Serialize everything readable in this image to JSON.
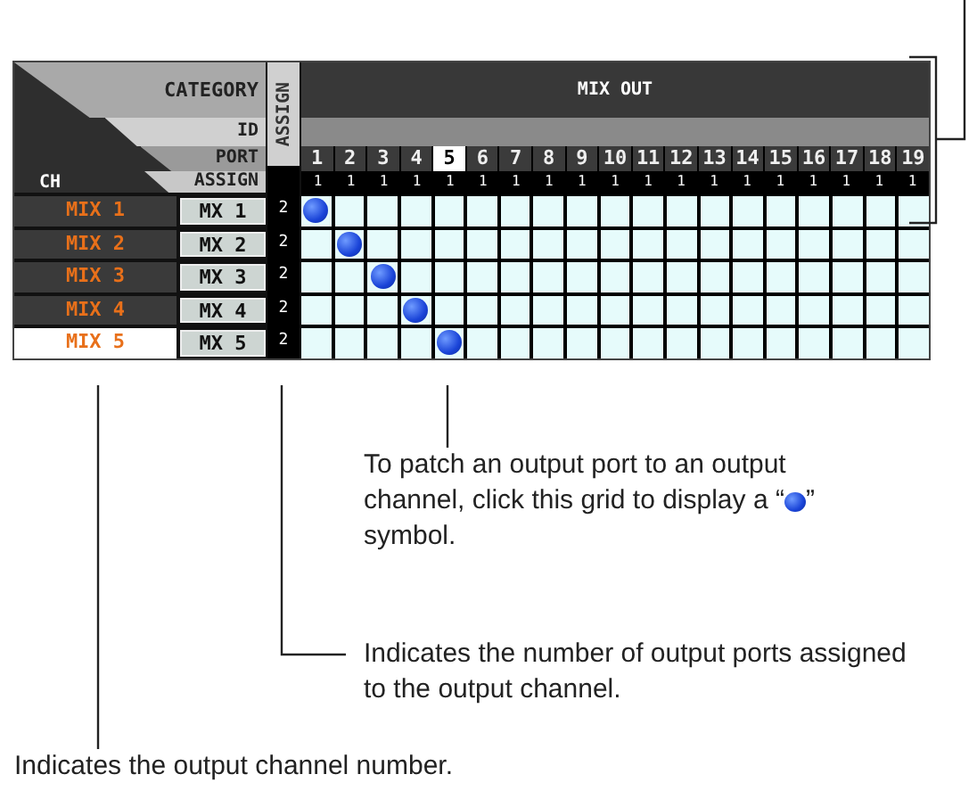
{
  "header": {
    "category_label": "CATEGORY",
    "id_label": "ID",
    "port_label": "PORT",
    "assign_label": "ASSIGN",
    "ch_label": "CH",
    "assign_column_label": "ASSIGN",
    "category": "MIX OUT"
  },
  "ports": [
    {
      "label": "1",
      "selected": false,
      "assign": "1"
    },
    {
      "label": "2",
      "selected": false,
      "assign": "1"
    },
    {
      "label": "3",
      "selected": false,
      "assign": "1"
    },
    {
      "label": "4",
      "selected": false,
      "assign": "1"
    },
    {
      "label": "5",
      "selected": true,
      "assign": "1"
    },
    {
      "label": "6",
      "selected": false,
      "assign": "1"
    },
    {
      "label": "7",
      "selected": false,
      "assign": "1"
    },
    {
      "label": "8",
      "selected": false,
      "assign": "1"
    },
    {
      "label": "9",
      "selected": false,
      "assign": "1"
    },
    {
      "label": "10",
      "selected": false,
      "assign": "1"
    },
    {
      "label": "11",
      "selected": false,
      "assign": "1"
    },
    {
      "label": "12",
      "selected": false,
      "assign": "1"
    },
    {
      "label": "13",
      "selected": false,
      "assign": "1"
    },
    {
      "label": "14",
      "selected": false,
      "assign": "1"
    },
    {
      "label": "15",
      "selected": false,
      "assign": "1"
    },
    {
      "label": "16",
      "selected": false,
      "assign": "1"
    },
    {
      "label": "17",
      "selected": false,
      "assign": "1"
    },
    {
      "label": "18",
      "selected": false,
      "assign": "1"
    },
    {
      "label": "19",
      "selected": false,
      "assign": "1"
    }
  ],
  "channels": [
    {
      "name": "MIX 1",
      "button": "MX 1",
      "assign": "2",
      "selected": false,
      "patched": [
        true,
        false,
        false,
        false,
        false,
        false,
        false,
        false,
        false,
        false,
        false,
        false,
        false,
        false,
        false,
        false,
        false,
        false,
        false
      ]
    },
    {
      "name": "MIX 2",
      "button": "MX 2",
      "assign": "2",
      "selected": false,
      "patched": [
        false,
        true,
        false,
        false,
        false,
        false,
        false,
        false,
        false,
        false,
        false,
        false,
        false,
        false,
        false,
        false,
        false,
        false,
        false
      ]
    },
    {
      "name": "MIX 3",
      "button": "MX 3",
      "assign": "2",
      "selected": false,
      "patched": [
        false,
        false,
        true,
        false,
        false,
        false,
        false,
        false,
        false,
        false,
        false,
        false,
        false,
        false,
        false,
        false,
        false,
        false,
        false
      ]
    },
    {
      "name": "MIX 4",
      "button": "MX 4",
      "assign": "2",
      "selected": false,
      "patched": [
        false,
        false,
        false,
        true,
        false,
        false,
        false,
        false,
        false,
        false,
        false,
        false,
        false,
        false,
        false,
        false,
        false,
        false,
        false
      ]
    },
    {
      "name": "MIX 5",
      "button": "MX 5",
      "assign": "2",
      "selected": true,
      "patched": [
        false,
        false,
        false,
        false,
        true,
        false,
        false,
        false,
        false,
        false,
        false,
        false,
        false,
        false,
        false,
        false,
        false,
        false,
        false
      ]
    }
  ],
  "callouts": {
    "grid_line_1": "To patch an output port to an output",
    "grid_line_2": "channel, click this grid to display a “",
    "grid_quote": "”",
    "grid_line_3": "symbol.",
    "assign": "Indicates the number of output ports assigned to the output channel.",
    "channel": "Indicates the output channel number."
  }
}
